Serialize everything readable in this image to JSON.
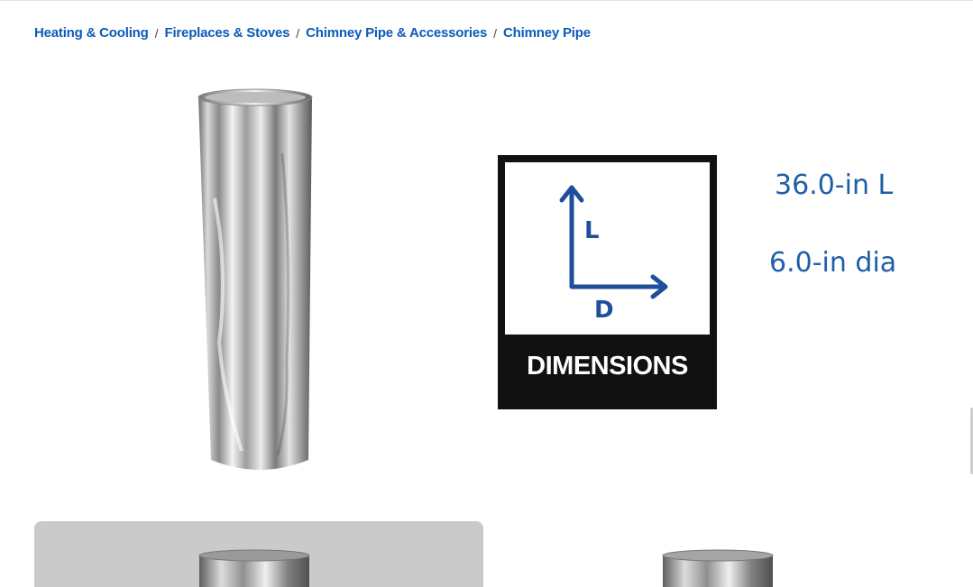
{
  "breadcrumb": [
    {
      "label": "Heating & Cooling"
    },
    {
      "label": "Fireplaces & Stoves"
    },
    {
      "label": "Chimney Pipe & Accessories"
    },
    {
      "label": "Chimney Pipe"
    }
  ],
  "dimensions": {
    "label": "DIMENSIONS",
    "axis_length": "L",
    "axis_diameter": "D",
    "length": "36.0-in L",
    "diameter": "6.0-in dia"
  },
  "colors": {
    "link": "#0b5bb8",
    "dimension_blue": "#1f5fa8",
    "thumb_bg": "#cacaca"
  }
}
